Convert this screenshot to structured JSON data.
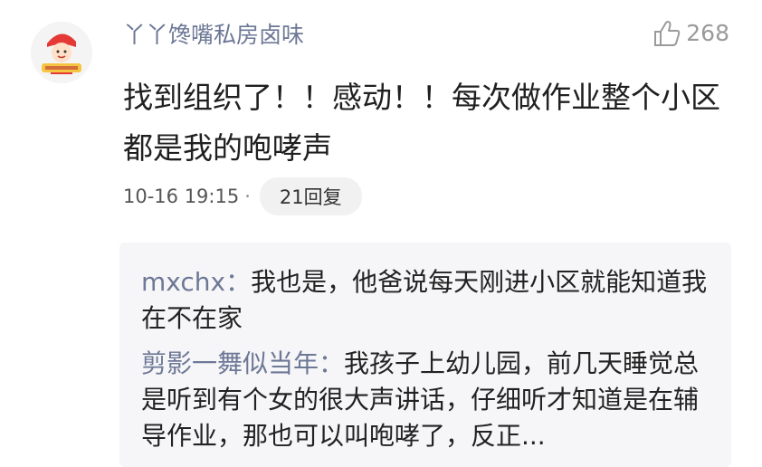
{
  "comment": {
    "username": "丫丫馋嘴私房卤味",
    "like_count": "268",
    "text": "找到组织了！！感动！！每次做作业整个小区都是我的咆哮声",
    "timestamp": "10-16 19:15",
    "separator_dot": "·",
    "reply_count_label": "21回复"
  },
  "replies": [
    {
      "name": "mxchx",
      "separator": "：",
      "text": "我也是，他爸说每天刚进小区就能知道我在不在家"
    },
    {
      "name": "剪影一舞似当年",
      "separator": "：",
      "text": "我孩子上幼儿园，前几天睡觉总是听到有个女的很大声讲话，仔细听才知道是在辅导作业，那也可以叫咆哮了，反正..."
    }
  ],
  "colors": {
    "username": "#6d7896",
    "text": "#202020",
    "reply_bg": "#f6f6f8",
    "avatar_accent": "#e53935"
  },
  "icons": {
    "like": "thumbs-up-icon",
    "avatar": "cartoon-avatar"
  }
}
